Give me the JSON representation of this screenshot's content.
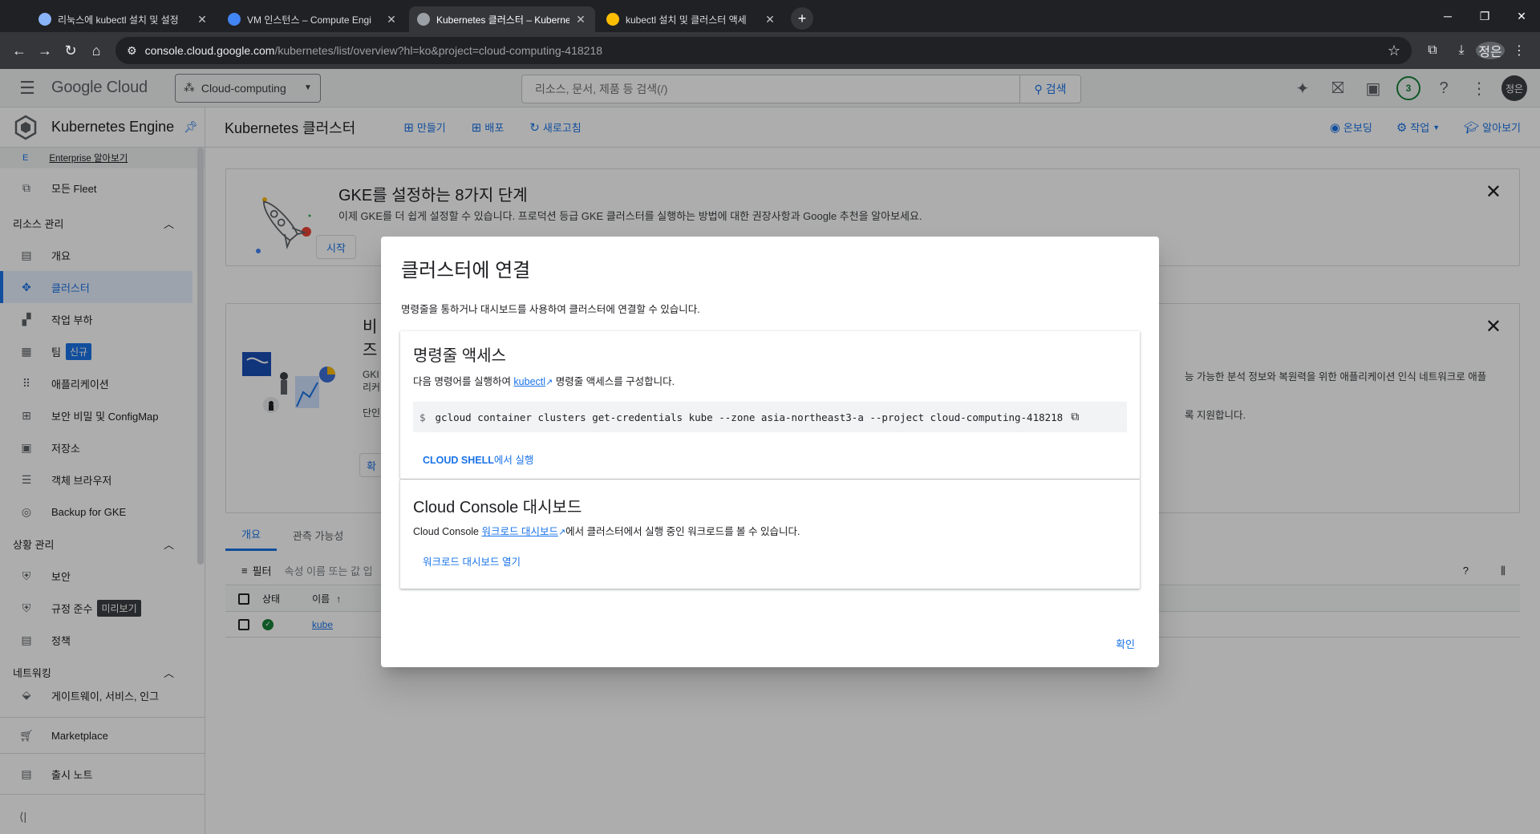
{
  "browser": {
    "tabs": [
      {
        "title": "리눅스에 kubectl 설치 및 설정",
        "favicon_color": "#8ab4f8",
        "active": false
      },
      {
        "title": "VM 인스턴스 – Compute Engi",
        "favicon_color": "#4285f4",
        "active": false
      },
      {
        "title": "Kubernetes 클러스터 – Kuberne",
        "favicon_color": "#9aa0a6",
        "active": true
      },
      {
        "title": "kubectl 설치 및 클러스터 액세",
        "favicon_color": "#fbbc04",
        "active": false
      }
    ],
    "url_host": "console.cloud.google.com",
    "url_path": "/kubernetes/list/overview?hl=ko&project=cloud-computing-418218",
    "profile_initials": "정은"
  },
  "header": {
    "logo_google": "Google",
    "logo_cloud": "Cloud",
    "project": "Cloud-computing",
    "search_placeholder": "리소스, 문서, 제품 등 검색(/)",
    "search_button": "검색",
    "notification_count": "3",
    "avatar": "정은"
  },
  "sidebar": {
    "product": "Kubernetes Engine",
    "enterprise_badge": "E",
    "enterprise_link": "Enterprise 알아보기",
    "fleet": "모든 Fleet",
    "section_resource": "리소스 관리",
    "resource_items": [
      {
        "label": "개요",
        "icon": "overview-icon",
        "glyph": "▤"
      },
      {
        "label": "클러스터",
        "icon": "clusters-icon",
        "glyph": "✥",
        "active": true
      },
      {
        "label": "작업 부하",
        "icon": "workloads-icon",
        "glyph": "▞"
      },
      {
        "label": "팀",
        "icon": "teams-icon",
        "glyph": "▦",
        "chip": "신규"
      },
      {
        "label": "애플리케이션",
        "icon": "applications-icon",
        "glyph": "⠿"
      },
      {
        "label": "보안 비밀 및 ConfigMap",
        "icon": "secrets-icon",
        "glyph": "⊞"
      },
      {
        "label": "저장소",
        "icon": "storage-icon",
        "glyph": "▣"
      },
      {
        "label": "객체 브라우저",
        "icon": "object-browser-icon",
        "glyph": "☰"
      },
      {
        "label": "Backup for GKE",
        "icon": "backup-icon",
        "glyph": "◎"
      }
    ],
    "section_posture": "상황 관리",
    "posture_items": [
      {
        "label": "보안",
        "icon": "security-icon",
        "glyph": "⛨"
      },
      {
        "label": "규정 준수",
        "icon": "compliance-icon",
        "glyph": "⛨",
        "chip": "미리보기"
      },
      {
        "label": "정책",
        "icon": "policy-icon",
        "glyph": "▤"
      }
    ],
    "section_network": "네트워킹",
    "network_partial": "게이트웨이, 서비스, 인그",
    "marketplace": "Marketplace",
    "release_notes": "출시 노트"
  },
  "toolbar": {
    "title": "Kubernetes 클러스터",
    "create": "만들기",
    "deploy": "배포",
    "refresh": "새로고침",
    "onboarding": "온보딩",
    "operations": "작업",
    "learn": "알아보기"
  },
  "banner1": {
    "title": "GKE를 설정하는 8가지 단계",
    "desc": "이제 GKE를 더 쉽게 설정할 수 있습니다. 프로덕션 등급 GKE 클러스터를 실행하는 방법에 대한 권장사항과 Google 추천을 알아보세요.",
    "button": "시작"
  },
  "banner2": {
    "peek_title": "비",
    "peek_title2": "즈",
    "peek_text1": "능 가능한 분석 정보와 복원력을 위한 애플리케이션 인식 네트워크로 애플",
    "peek_text2": "록 지원합니다.",
    "peek_left1": "GKI",
    "peek_left2": "리커",
    "peek_left3": "단인",
    "peek_btn": "확"
  },
  "list": {
    "tabs": [
      "개요",
      "관측 가능성"
    ],
    "filter_label": "필터",
    "filter_placeholder": "속성 이름 또는 값 입",
    "col_status": "상태",
    "col_name": "이름",
    "row_name": "kube"
  },
  "dialog": {
    "title": "클러스터에 연결",
    "subtitle": "명령줄을 통하거나 대시보드를 사용하여 클러스터에 연결할 수 있습니다.",
    "cli_title": "명령줄 액세스",
    "cli_desc_before": "다음 명령어를 실행하여 ",
    "cli_desc_link": "kubectl",
    "cli_desc_after": " 명령줄 액세스를 구성합니다.",
    "command": "gcloud container clusters get-credentials kube --zone asia-northeast3-a --project cloud-computing-418218",
    "run_shell_bold": "CLOUD SHELL",
    "run_shell_rest": "에서 실행",
    "console_title": "Cloud Console 대시보드",
    "console_desc_before": "Cloud Console ",
    "console_desc_link": "워크로드 대시보드",
    "console_desc_after": "에서 클러스터에서 실행 중인 워크로드를 볼 수 있습니다.",
    "open_workload": "워크로드 대시보드 열기",
    "confirm": "확인"
  },
  "colors": {
    "accent": "#1a73e8",
    "success": "#188038",
    "overlay": "rgba(0,0,0,0.32)"
  }
}
